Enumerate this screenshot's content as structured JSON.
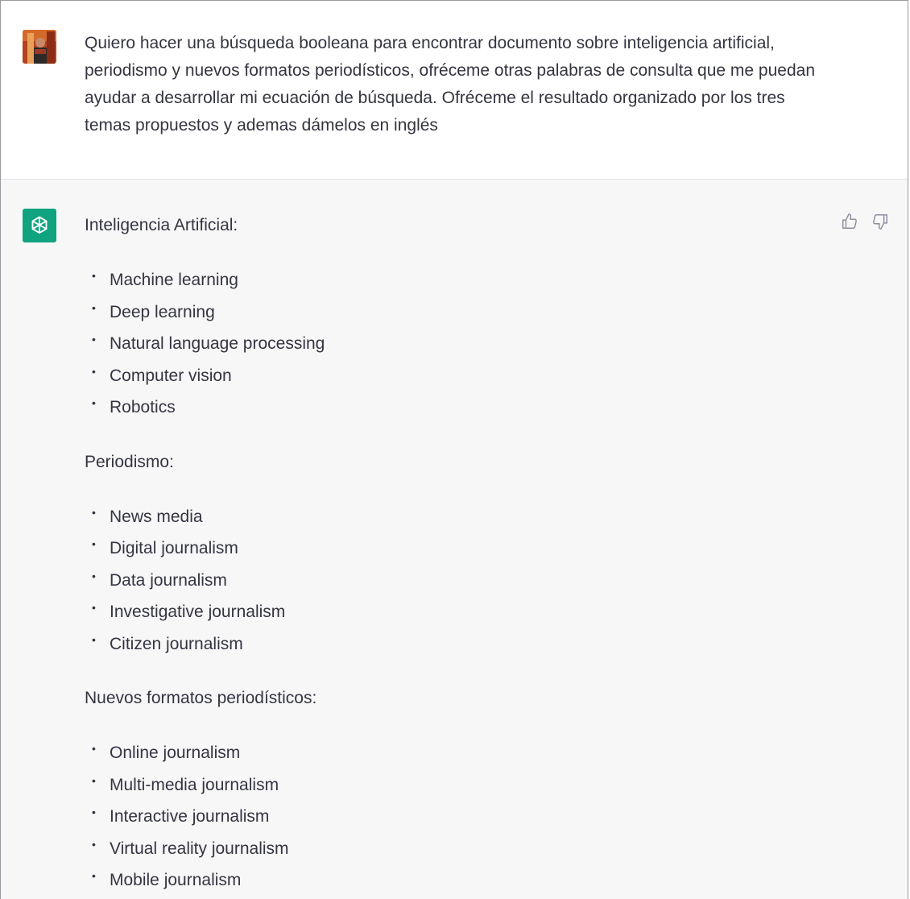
{
  "user_message": {
    "text": "Quiero hacer una búsqueda booleana para encontrar documento sobre inteligencia artificial, periodismo y nuevos formatos periodísticos, ofréceme otras palabras de consulta que me puedan ayudar a desarrollar mi ecuación de búsqueda. Ofréceme el resultado organizado por los tres temas propuestos y ademas dámelos en inglés",
    "avatar_icon": "user-photo-avatar"
  },
  "assistant_message": {
    "avatar_icon": "openai-logo-icon",
    "avatar_color": "#10a37f",
    "sections": [
      {
        "title": "Inteligencia Artificial:",
        "items": [
          "Machine learning",
          "Deep learning",
          "Natural language processing",
          "Computer vision",
          "Robotics"
        ]
      },
      {
        "title": "Periodismo:",
        "items": [
          "News media",
          "Digital journalism",
          "Data journalism",
          "Investigative journalism",
          "Citizen journalism"
        ]
      },
      {
        "title": "Nuevos formatos periodísticos:",
        "items": [
          "Online journalism",
          "Multi-media journalism",
          "Interactive journalism",
          "Virtual reality journalism",
          "Mobile journalism"
        ]
      }
    ],
    "bullet_glyph": "•",
    "feedback": {
      "like_icon": "thumbs-up-icon",
      "dislike_icon": "thumbs-down-icon"
    }
  },
  "colors": {
    "user_bg": "#ffffff",
    "assistant_bg": "#f7f7f8",
    "text": "#343541",
    "accent": "#10a37f"
  }
}
